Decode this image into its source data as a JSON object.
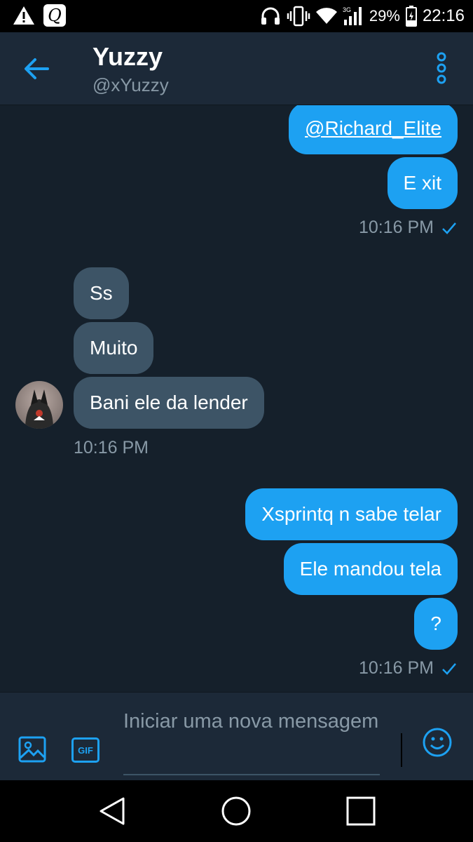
{
  "status_bar": {
    "battery": "29%",
    "network": "3G",
    "time": "22:16",
    "left_icons": [
      "warning-icon",
      "quora-notification-icon"
    ],
    "right_icons": [
      "headphones-icon",
      "vibrate-icon",
      "wifi-icon",
      "cell-signal-icon",
      "battery-icon"
    ]
  },
  "header": {
    "name": "Yuzzy",
    "handle": "@xYuzzy",
    "accent": "#1da1f2"
  },
  "messages": [
    {
      "direction": "out",
      "text": "@Richard_Elite",
      "link": true
    },
    {
      "direction": "out",
      "text": "E xit"
    },
    {
      "direction": "out_time",
      "text": "10:16 PM",
      "read": true
    },
    {
      "direction": "in",
      "text": "Ss"
    },
    {
      "direction": "in",
      "text": "Muito"
    },
    {
      "direction": "in",
      "text": "Bani ele da lender"
    },
    {
      "direction": "in_time",
      "text": "10:16 PM"
    },
    {
      "direction": "out",
      "text": "Xsprintq n sabe telar"
    },
    {
      "direction": "out",
      "text": "Ele mandou tela"
    },
    {
      "direction": "out",
      "text": "?"
    },
    {
      "direction": "out_time",
      "text": "10:16 PM",
      "read": true
    }
  ],
  "composer": {
    "placeholder": "Iniciar uma nova mensagem",
    "gif_label": "GIF"
  },
  "colors": {
    "background": "#15202b",
    "header": "#1c2938",
    "outgoing_bubble": "#1da1f2",
    "incoming_bubble": "#3d5466",
    "muted_text": "#8899a6"
  }
}
